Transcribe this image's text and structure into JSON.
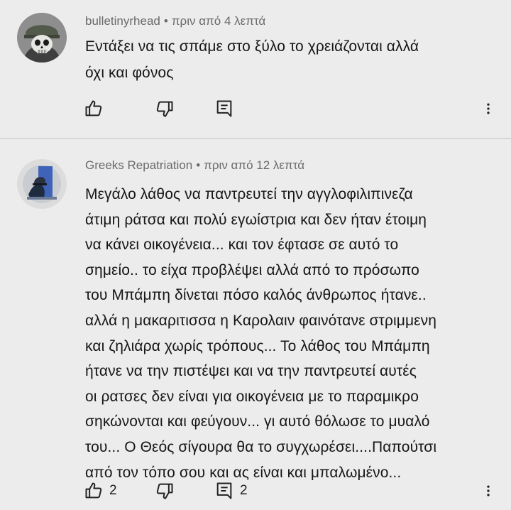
{
  "comments": [
    {
      "author": "bulletinyrhead",
      "separator": "•",
      "time": "πριν από 4 λεπτά",
      "text": "Εντάξει να τις σπάμε στο ξύλο το χρειάζονται αλλά\nόχι και φόνος",
      "likes": "",
      "replies": "",
      "avatar_icon": "skull-soldier-avatar-icon"
    },
    {
      "author": "Greeks Repatriation",
      "separator": "•",
      "time": "πριν από 12 λεπτά",
      "text": "Μεγάλο λάθος να παντρευτεί την αγγλοφιλιπινεζα\nάτιμη ράτσα και πολύ εγωίστρια και δεν ήταν έτοιμη\nνα κάνει οικογένεια... και τον έφτασε σε αυτό το\nσημείο.. το είχα προβλέψει αλλά από το πρόσωπο\nτου Μπάμπη δίνεται πόσο καλός άνθρωπος ήτανε..\nαλλά η μακαριτισσα η Καρολαιν φαινότανε στριμμενη\nκαι ζηλιάρα χωρίς τρόπους... Το λάθος του Μπάμπη\nήτανε να την πιστέψει και να την παντρευτεί αυτές\nοι ρατσες δεν είναι για οικογένεια με το παραμικρο\nσηκώνονται και φεύγουν... γι αυτό θόλωσε το μυαλό\nτου... Ο Θεός σίγουρα θα το συγχωρέσει....Παπούτσι\nαπό τον τόπο σου και ας είναι και μπαλωμένο...",
      "likes": "2",
      "replies": "2",
      "avatar_icon": "helmeted-figure-avatar-icon"
    }
  ],
  "icons": {
    "like": "thumbs-up-icon",
    "dislike": "thumbs-down-icon",
    "reply": "reply-icon",
    "more": "more-vertical-icon"
  },
  "colors": {
    "background": "#ececec",
    "meta_text": "#6a6a6a",
    "body_text": "#161616",
    "divider": "#d6d6d6"
  }
}
